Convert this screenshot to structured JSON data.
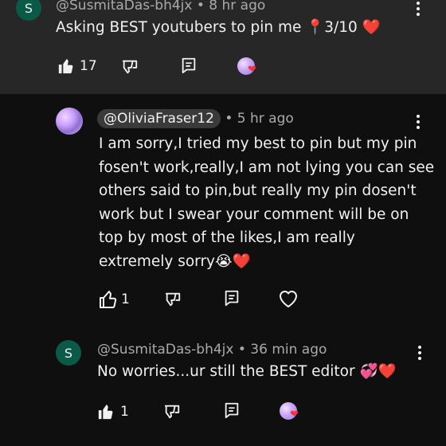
{
  "comment_top": {
    "avatar_letter": "S",
    "handle": "@SusmitaDas-bh4jx",
    "time": "• 8 hr ago",
    "text": "Asking BEST youtubers to pin me 📍3/10 ❤️",
    "like_count": "17"
  },
  "reply_olivia": {
    "handle": "@OliviaFraser12",
    "time": "• 5 hr ago",
    "lines": [
      "I am sorry,I tried my best to pin but my pin",
      "fosen't work,really,I am not lying you can see",
      "others said to pin,but really my pin dosen't",
      "work but I swear your comment will be on",
      "top by most of the likes,I am really",
      "extremely sorry😭❤️"
    ],
    "like_count": "1"
  },
  "reply_susmita": {
    "avatar_letter": "S",
    "handle": "@SusmitaDas-bh4jx",
    "time": "• 36 min ago",
    "text": "No worries...ur still the BEST editor 💞❤️",
    "like_count": "1"
  },
  "icons": {
    "like": "thumbs-up-icon",
    "dislike": "thumbs-down-icon",
    "reply": "reply-comment-icon",
    "heart": "heart-icon",
    "creator_heart": "creator-heart-icon",
    "more": "more-vert-icon"
  },
  "colors": {
    "background": "#0f0f0f",
    "highlight_card": "#272727",
    "avatar_green": "#0b5a48",
    "heart_red": "#ff2d3a"
  }
}
